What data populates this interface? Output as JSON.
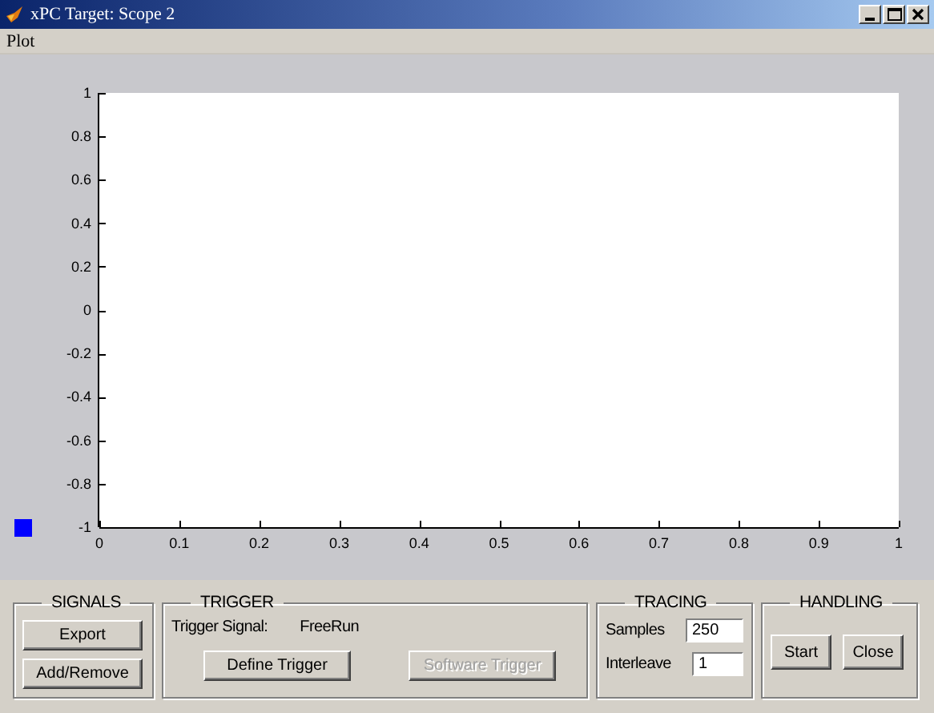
{
  "window": {
    "title": "xPC Target: Scope 2"
  },
  "menu": [
    "Plot"
  ],
  "plot": {
    "chart_data": {
      "type": "line",
      "xlim": [
        0,
        1
      ],
      "ylim": [
        -1,
        1
      ],
      "xticks": [
        0,
        0.1,
        0.2,
        0.3,
        0.4,
        0.5,
        0.6,
        0.7,
        0.8,
        0.9,
        1
      ],
      "yticks": [
        -1,
        -0.8,
        -0.6,
        -0.4,
        -0.2,
        0,
        0.2,
        0.4,
        0.6,
        0.8,
        1
      ]
    }
  },
  "signals": {
    "title": "SIGNALS",
    "buttons": [
      {
        "label": "Export",
        "disabled": false
      },
      {
        "label": "Add/Remove",
        "disabled": false
      }
    ]
  },
  "trigger": {
    "title": "TRIGGER",
    "signal_label": "Trigger Signal:",
    "signal_value": "FreeRun",
    "buttons": [
      {
        "label": "Define Trigger",
        "disabled": false
      },
      {
        "label": "Software Trigger",
        "disabled": true
      }
    ]
  },
  "tracing": {
    "title": "TRACING",
    "fields": [
      {
        "label": "Samples",
        "value": "250"
      },
      {
        "label": "Interleave",
        "value": "1"
      }
    ]
  },
  "handling": {
    "title": "HANDLING",
    "buttons": [
      {
        "label": "Start",
        "disabled": false
      },
      {
        "label": "Close",
        "disabled": false
      }
    ]
  }
}
